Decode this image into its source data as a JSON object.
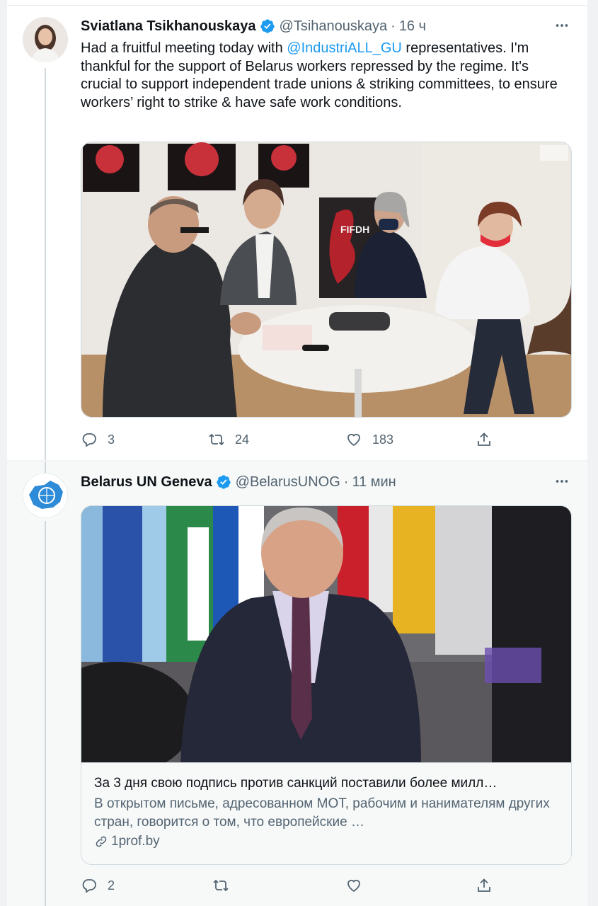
{
  "tweets": [
    {
      "author_name": "Sviatlana Tsikhanouskaya",
      "handle": "@Tsihanouskaya",
      "separator": "·",
      "time": "16 ч",
      "text_before": "Had a fruitful meeting today with ",
      "mention": "@IndustriALL_GU",
      "text_after": " representatives. I'm thankful for the support of Belarus workers repressed by the regime. It's crucial to support independent trade unions & striking committees, to ensure workers’ right to strike & have safe work conditions.",
      "media_logo_text": "FIFDH",
      "replies": "3",
      "retweets": "24",
      "likes": "183"
    },
    {
      "author_name": "Belarus UN Geneva",
      "handle": "@BelarusUNOG",
      "separator": "·",
      "time": "11 мин",
      "link_title": "За 3 дня свою подпись против санкций поставили более милл…",
      "link_description": "В открытом письме, адресованном МОТ, рабочим и нанимателям других стран, говорится о том, что европейские …",
      "link_domain": "1prof.by",
      "replies": "2",
      "retweets": "",
      "likes": ""
    }
  ],
  "colors": {
    "accent": "#1d9bf0",
    "muted": "#536471",
    "text": "#0f1419"
  },
  "icons": [
    "more-icon",
    "verified-icon",
    "reply-icon",
    "retweet-icon",
    "like-icon",
    "share-icon",
    "link-icon"
  ]
}
